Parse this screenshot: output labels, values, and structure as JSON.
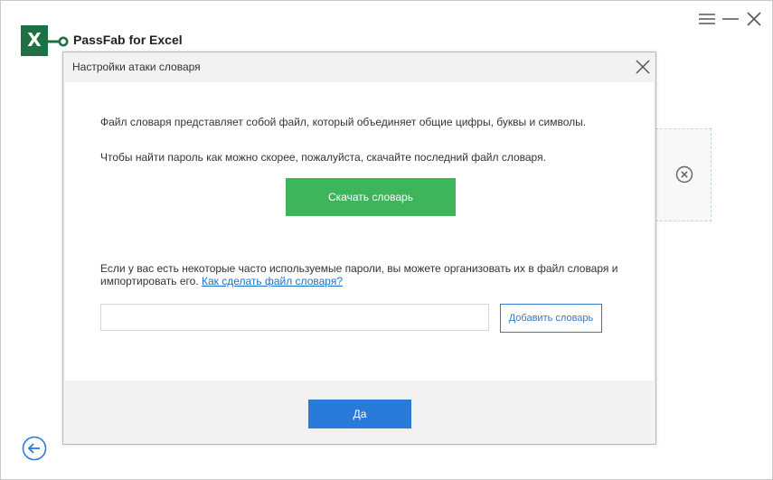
{
  "app": {
    "title": "PassFab for Excel",
    "logo_letter": "X"
  },
  "window_controls": {
    "menu_icon": "hamburger-icon",
    "minimize_icon": "minimize-icon",
    "close_icon": "close-icon"
  },
  "dialog": {
    "title": "Настройки атаки словаря",
    "description_1": "Файл словаря представляет собой файл, который объединяет общие цифры, буквы и символы.",
    "description_2": "Чтобы найти пароль как можно скорее, пожалуйста, скачайте последний файл словаря.",
    "download_button": "Скачать словарь",
    "import_text_1": "Если у вас есть некоторые часто используемые пароли, вы можете организовать их в файл словаря и",
    "import_text_2": "импортировать его. ",
    "how_to_link": "Как сделать файл словаря?",
    "file_input_value": "",
    "add_dictionary_button": "Добавить словарь",
    "ok_button": "Да"
  },
  "colors": {
    "excel_green": "#1e7145",
    "download_green": "#3cb55b",
    "primary_blue": "#2a7ad9",
    "link_blue": "#1a73c8"
  }
}
